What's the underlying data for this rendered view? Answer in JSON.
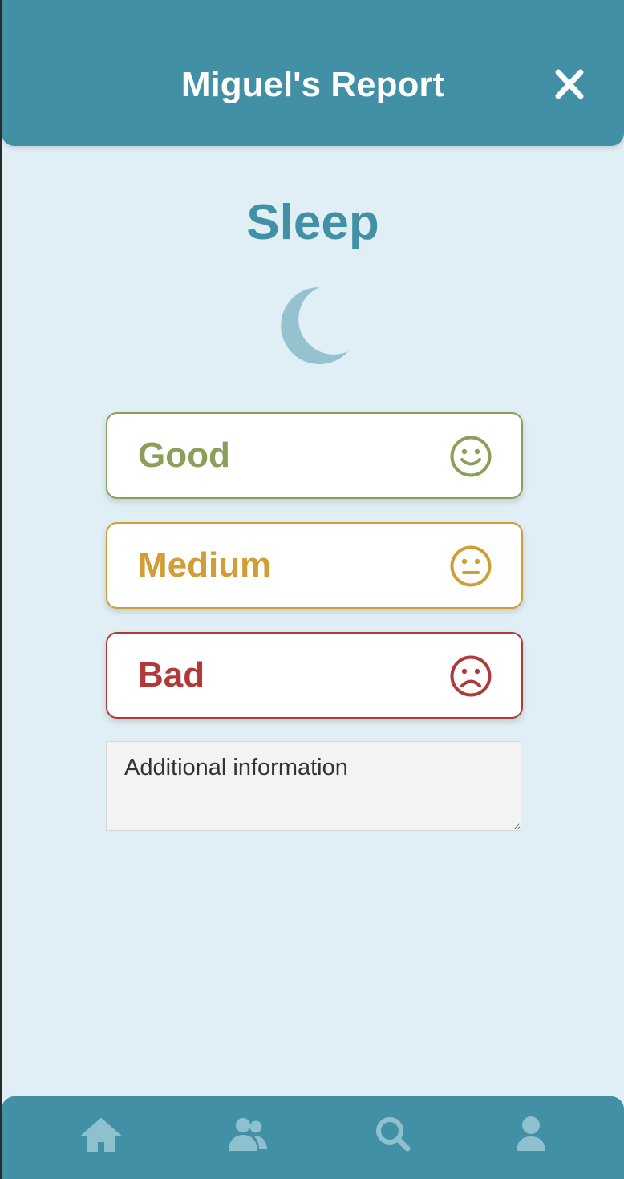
{
  "header": {
    "title": "Miguel's Report",
    "close_icon": "close-icon"
  },
  "section": {
    "title": "Sleep",
    "icon": "moon-icon"
  },
  "options": [
    {
      "label": "Good",
      "icon": "smile-face-icon",
      "color": "#8c9f5a"
    },
    {
      "label": "Medium",
      "icon": "neutral-face-icon",
      "color": "#d09d36"
    },
    {
      "label": "Bad",
      "icon": "sad-face-icon",
      "color": "#b03a3a"
    }
  ],
  "additional_info": {
    "placeholder": "Additional information",
    "value": ""
  },
  "nav": {
    "items": [
      {
        "icon": "home-icon"
      },
      {
        "icon": "users-icon"
      },
      {
        "icon": "search-icon"
      },
      {
        "icon": "profile-icon"
      }
    ]
  },
  "colors": {
    "primary": "#4190a5",
    "background": "#e0eff5",
    "moon": "#94c2cf",
    "nav_icon": "#8ec0cd",
    "header_text": "#ffffff"
  }
}
